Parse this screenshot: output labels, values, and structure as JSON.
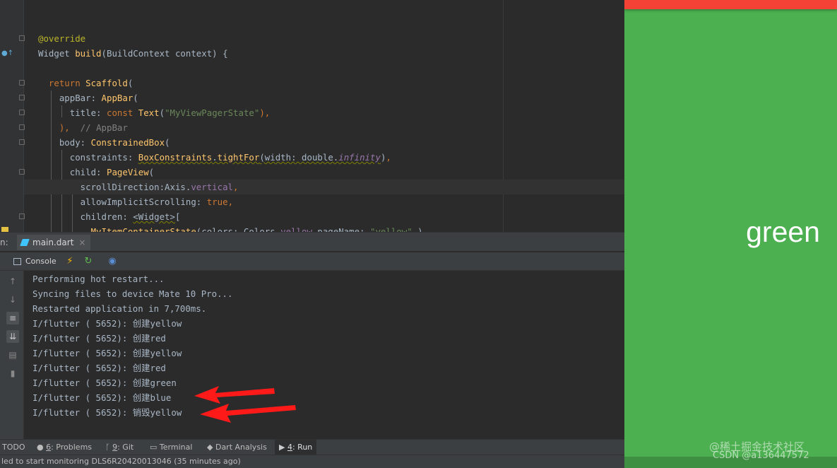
{
  "editor": {
    "code_lines": [
      {
        "id": "l-override",
        "segments": [
          {
            "t": "@override",
            "c": "an"
          }
        ]
      },
      {
        "id": "l-build",
        "segments": [
          {
            "t": "Widget ",
            "c": ""
          },
          {
            "t": "build",
            "c": "fn"
          },
          {
            "t": "(BuildContext context) {",
            "c": ""
          }
        ]
      },
      {
        "id": "l-blank",
        "segments": []
      },
      {
        "id": "l-return",
        "segments": [
          {
            "t": "  return ",
            "c": "kw"
          },
          {
            "t": "Scaffold",
            "c": "fn"
          },
          {
            "t": "(",
            "c": ""
          }
        ]
      },
      {
        "id": "l-appbar",
        "segments": [
          {
            "t": "    appBar: ",
            "c": ""
          },
          {
            "t": "AppBar",
            "c": "fn"
          },
          {
            "t": "(",
            "c": ""
          }
        ]
      },
      {
        "id": "l-title",
        "segments": [
          {
            "t": "      title: ",
            "c": ""
          },
          {
            "t": "const ",
            "c": "kw"
          },
          {
            "t": "Text",
            "c": "fn"
          },
          {
            "t": "(",
            "c": ""
          },
          {
            "t": "\"MyViewPagerState\"",
            "c": "st"
          },
          {
            "t": "),",
            "c": "kw"
          }
        ]
      },
      {
        "id": "l-close-appbar",
        "segments": [
          {
            "t": "    ),",
            "c": "kw"
          },
          {
            "t": "  // AppBar",
            "c": "cm"
          }
        ]
      },
      {
        "id": "l-body",
        "segments": [
          {
            "t": "    body: ",
            "c": ""
          },
          {
            "t": "ConstrainedBox",
            "c": "fn"
          },
          {
            "t": "(",
            "c": ""
          }
        ]
      },
      {
        "id": "l-constraints",
        "segments": [
          {
            "t": "      constraints: ",
            "c": ""
          },
          {
            "t": "BoxConstraints",
            "c": "fn wavy"
          },
          {
            "t": ".",
            "c": "wavy"
          },
          {
            "t": "tightFor",
            "c": "fn wavy"
          },
          {
            "t": "(width: double.",
            "c": "wavy"
          },
          {
            "t": "infinity",
            "c": "pr it wavy"
          },
          {
            "t": ")",
            "c": ""
          },
          {
            "t": ",",
            "c": "kw"
          }
        ]
      },
      {
        "id": "l-child",
        "segments": [
          {
            "t": "      child: ",
            "c": ""
          },
          {
            "t": "PageView",
            "c": "fn"
          },
          {
            "t": "(",
            "c": ""
          }
        ]
      },
      {
        "id": "l-scroll",
        "segments": [
          {
            "t": "        scrollDirection:Axis.",
            "c": ""
          },
          {
            "t": "vertical",
            "c": "pr"
          },
          {
            "t": ",",
            "c": "kw"
          }
        ]
      },
      {
        "id": "l-implicit",
        "segments": [
          {
            "t": "        allowImplicitScrolling: ",
            "c": ""
          },
          {
            "t": "true",
            "c": "kw"
          },
          {
            "t": ",",
            "c": "kw"
          }
        ]
      },
      {
        "id": "l-children",
        "segments": [
          {
            "t": "        children: ",
            "c": ""
          },
          {
            "t": "<Widget>",
            "c": "wavy"
          },
          {
            "t": "[",
            "c": ""
          }
        ]
      },
      {
        "id": "l-item",
        "segments": [
          {
            "t": "          MyItemContainerState",
            "c": "fn"
          },
          {
            "t": "(colors: Colors.",
            "c": ""
          },
          {
            "t": "yellow",
            "c": "pr"
          },
          {
            "t": ",pageName: ",
            "c": ""
          },
          {
            "t": "\"yellow\"",
            "c": "st"
          },
          {
            "t": ",),",
            "c": ""
          }
        ]
      }
    ]
  },
  "run_window": {
    "label": "n:",
    "tab": "main.dart",
    "tab_close": "×",
    "console_label": "Console"
  },
  "console_lines": [
    "Performing hot restart...",
    "Syncing files to device Mate 10 Pro...",
    "Restarted application in 7,700ms.",
    "I/flutter ( 5652): 创建yellow",
    "I/flutter ( 5652): 创建red",
    "I/flutter ( 5652): 创建yellow",
    "I/flutter ( 5652): 创建red",
    "I/flutter ( 5652): 创建green",
    "I/flutter ( 5652): 创建blue",
    "I/flutter ( 5652): 销毁yellow"
  ],
  "bottom_tabs": {
    "todo": "TODO",
    "problems_num": "6",
    "problems": ": Problems",
    "git_num": "9",
    "git": ": Git",
    "terminal": "Terminal",
    "dart_analysis": "Dart Analysis",
    "run_num": "4",
    "run": ": Run"
  },
  "status": "led to start monitoring DLS6R20420013046 (35 minutes ago)",
  "device": {
    "page_label": "green",
    "watermark_1": "@稀土掘金技术社区",
    "watermark_2": "CSDN @a136447572"
  },
  "colors": {
    "app_bar": "#f44336",
    "page_background": "#4caf50",
    "annotation_arrow": "#ff1a1a"
  }
}
